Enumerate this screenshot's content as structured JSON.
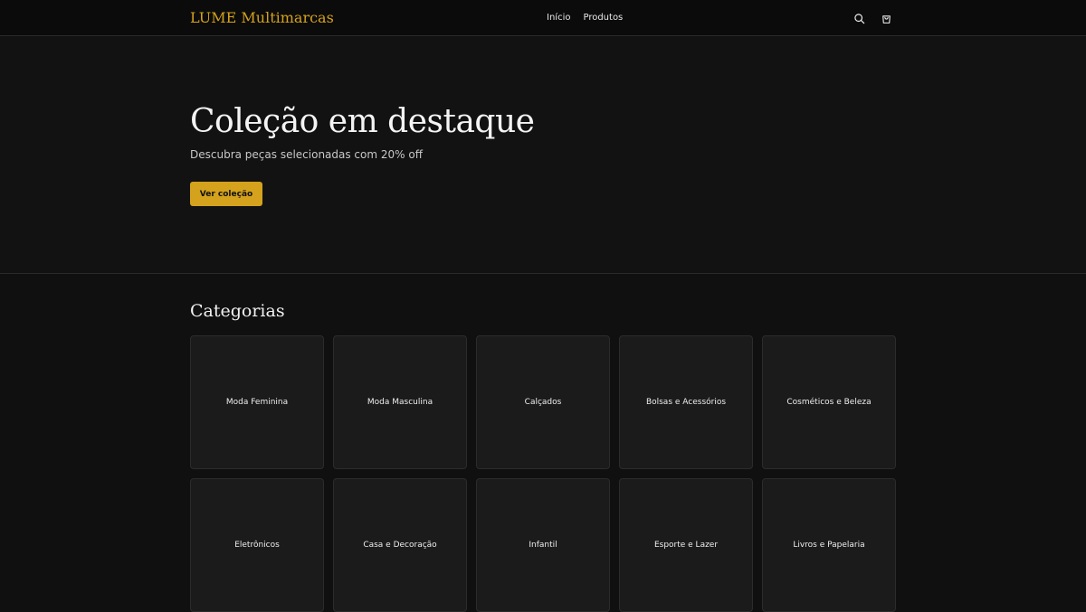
{
  "header": {
    "brand": "LUME Multimarcas",
    "nav": [
      {
        "label": "Início"
      },
      {
        "label": "Produtos"
      }
    ],
    "icons": {
      "search": "search-icon",
      "cart": "shopping-bag-icon"
    }
  },
  "hero": {
    "title": "Coleção em destaque",
    "subtitle": "Descubra peças selecionadas com 20% off",
    "cta_label": "Ver coleção"
  },
  "categories": {
    "title": "Categorias",
    "items": [
      {
        "label": "Moda Feminina"
      },
      {
        "label": "Moda Masculina"
      },
      {
        "label": "Calçados"
      },
      {
        "label": "Bolsas e Acessórios"
      },
      {
        "label": "Cosméticos e Beleza"
      },
      {
        "label": "Eletrônicos"
      },
      {
        "label": "Casa e Decoração"
      },
      {
        "label": "Infantil"
      },
      {
        "label": "Esporte e Lazer"
      },
      {
        "label": "Livros e Papelaria"
      }
    ]
  },
  "colors": {
    "accent": "#d4a21c",
    "background": "#101010",
    "card": "#1b1b1b"
  }
}
